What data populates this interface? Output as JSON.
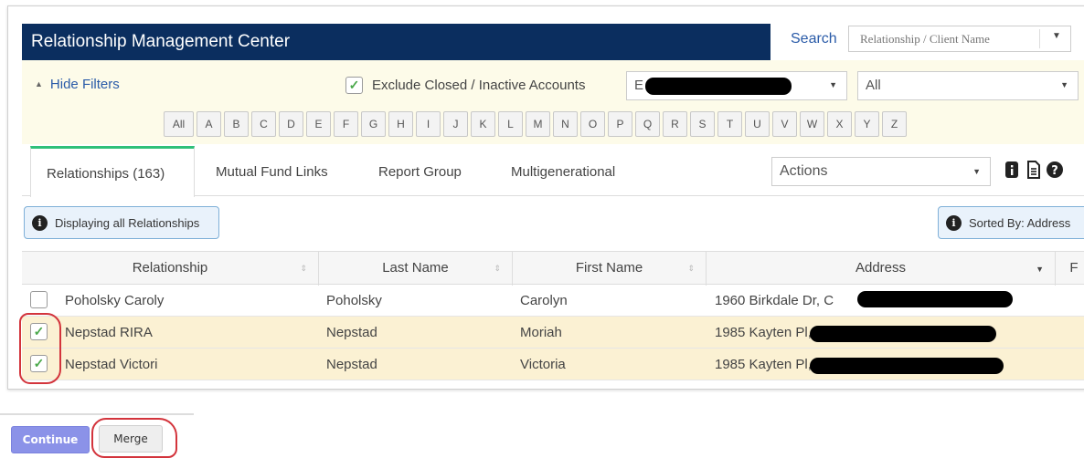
{
  "header": {
    "title": "Relationship Management Center",
    "search_label": "Search",
    "search_placeholder": "Relationship / Client Name"
  },
  "filters": {
    "hide_filters_label": "Hide Filters",
    "exclude_closed_label": "Exclude Closed / Inactive Accounts",
    "exclude_closed_checked": true,
    "advisor_select_value": "E",
    "status_select_value": "All",
    "letters": [
      "All",
      "A",
      "B",
      "C",
      "D",
      "E",
      "F",
      "G",
      "H",
      "I",
      "J",
      "K",
      "L",
      "M",
      "N",
      "O",
      "P",
      "Q",
      "R",
      "S",
      "T",
      "U",
      "V",
      "W",
      "X",
      "Y",
      "Z"
    ]
  },
  "tabs": {
    "items": [
      {
        "label": "Relationships (163)",
        "active": true
      },
      {
        "label": "Mutual Fund Links",
        "active": false
      },
      {
        "label": "Report Group",
        "active": false
      },
      {
        "label": "Multigenerational",
        "active": false
      }
    ],
    "actions_label": "Actions",
    "icons": [
      "info-box-icon",
      "document-icon",
      "help-icon"
    ]
  },
  "info": {
    "displaying": "Displaying all Relationships",
    "sorted_by": "Sorted By: Address"
  },
  "table": {
    "columns": [
      "Relationship",
      "Last Name",
      "First Name",
      "Address",
      "F"
    ],
    "rows": [
      {
        "checked": false,
        "relationship": "Poholsky Caroly",
        "last_name": "Poholsky",
        "first_name": "Carolyn",
        "address": "1960 Birkdale Dr, C"
      },
      {
        "checked": true,
        "relationship": "Nepstad RIRA",
        "last_name": "Nepstad",
        "first_name": "Moriah",
        "address": "1985 Kayten Pl,"
      },
      {
        "checked": true,
        "relationship": "Nepstad Victori",
        "last_name": "Nepstad",
        "first_name": "Victoria",
        "address": "1985 Kayten Pl,"
      }
    ]
  },
  "footer": {
    "continue_label": "Continue",
    "merge_label": "Merge"
  },
  "colors": {
    "title_bar": "#0b2e5f",
    "link": "#2a5ba8",
    "tab_accent": "#2fc07a",
    "selected_row": "#fbf1d3",
    "annotation": "#d3343c",
    "continue_button": "#8b92e8"
  }
}
